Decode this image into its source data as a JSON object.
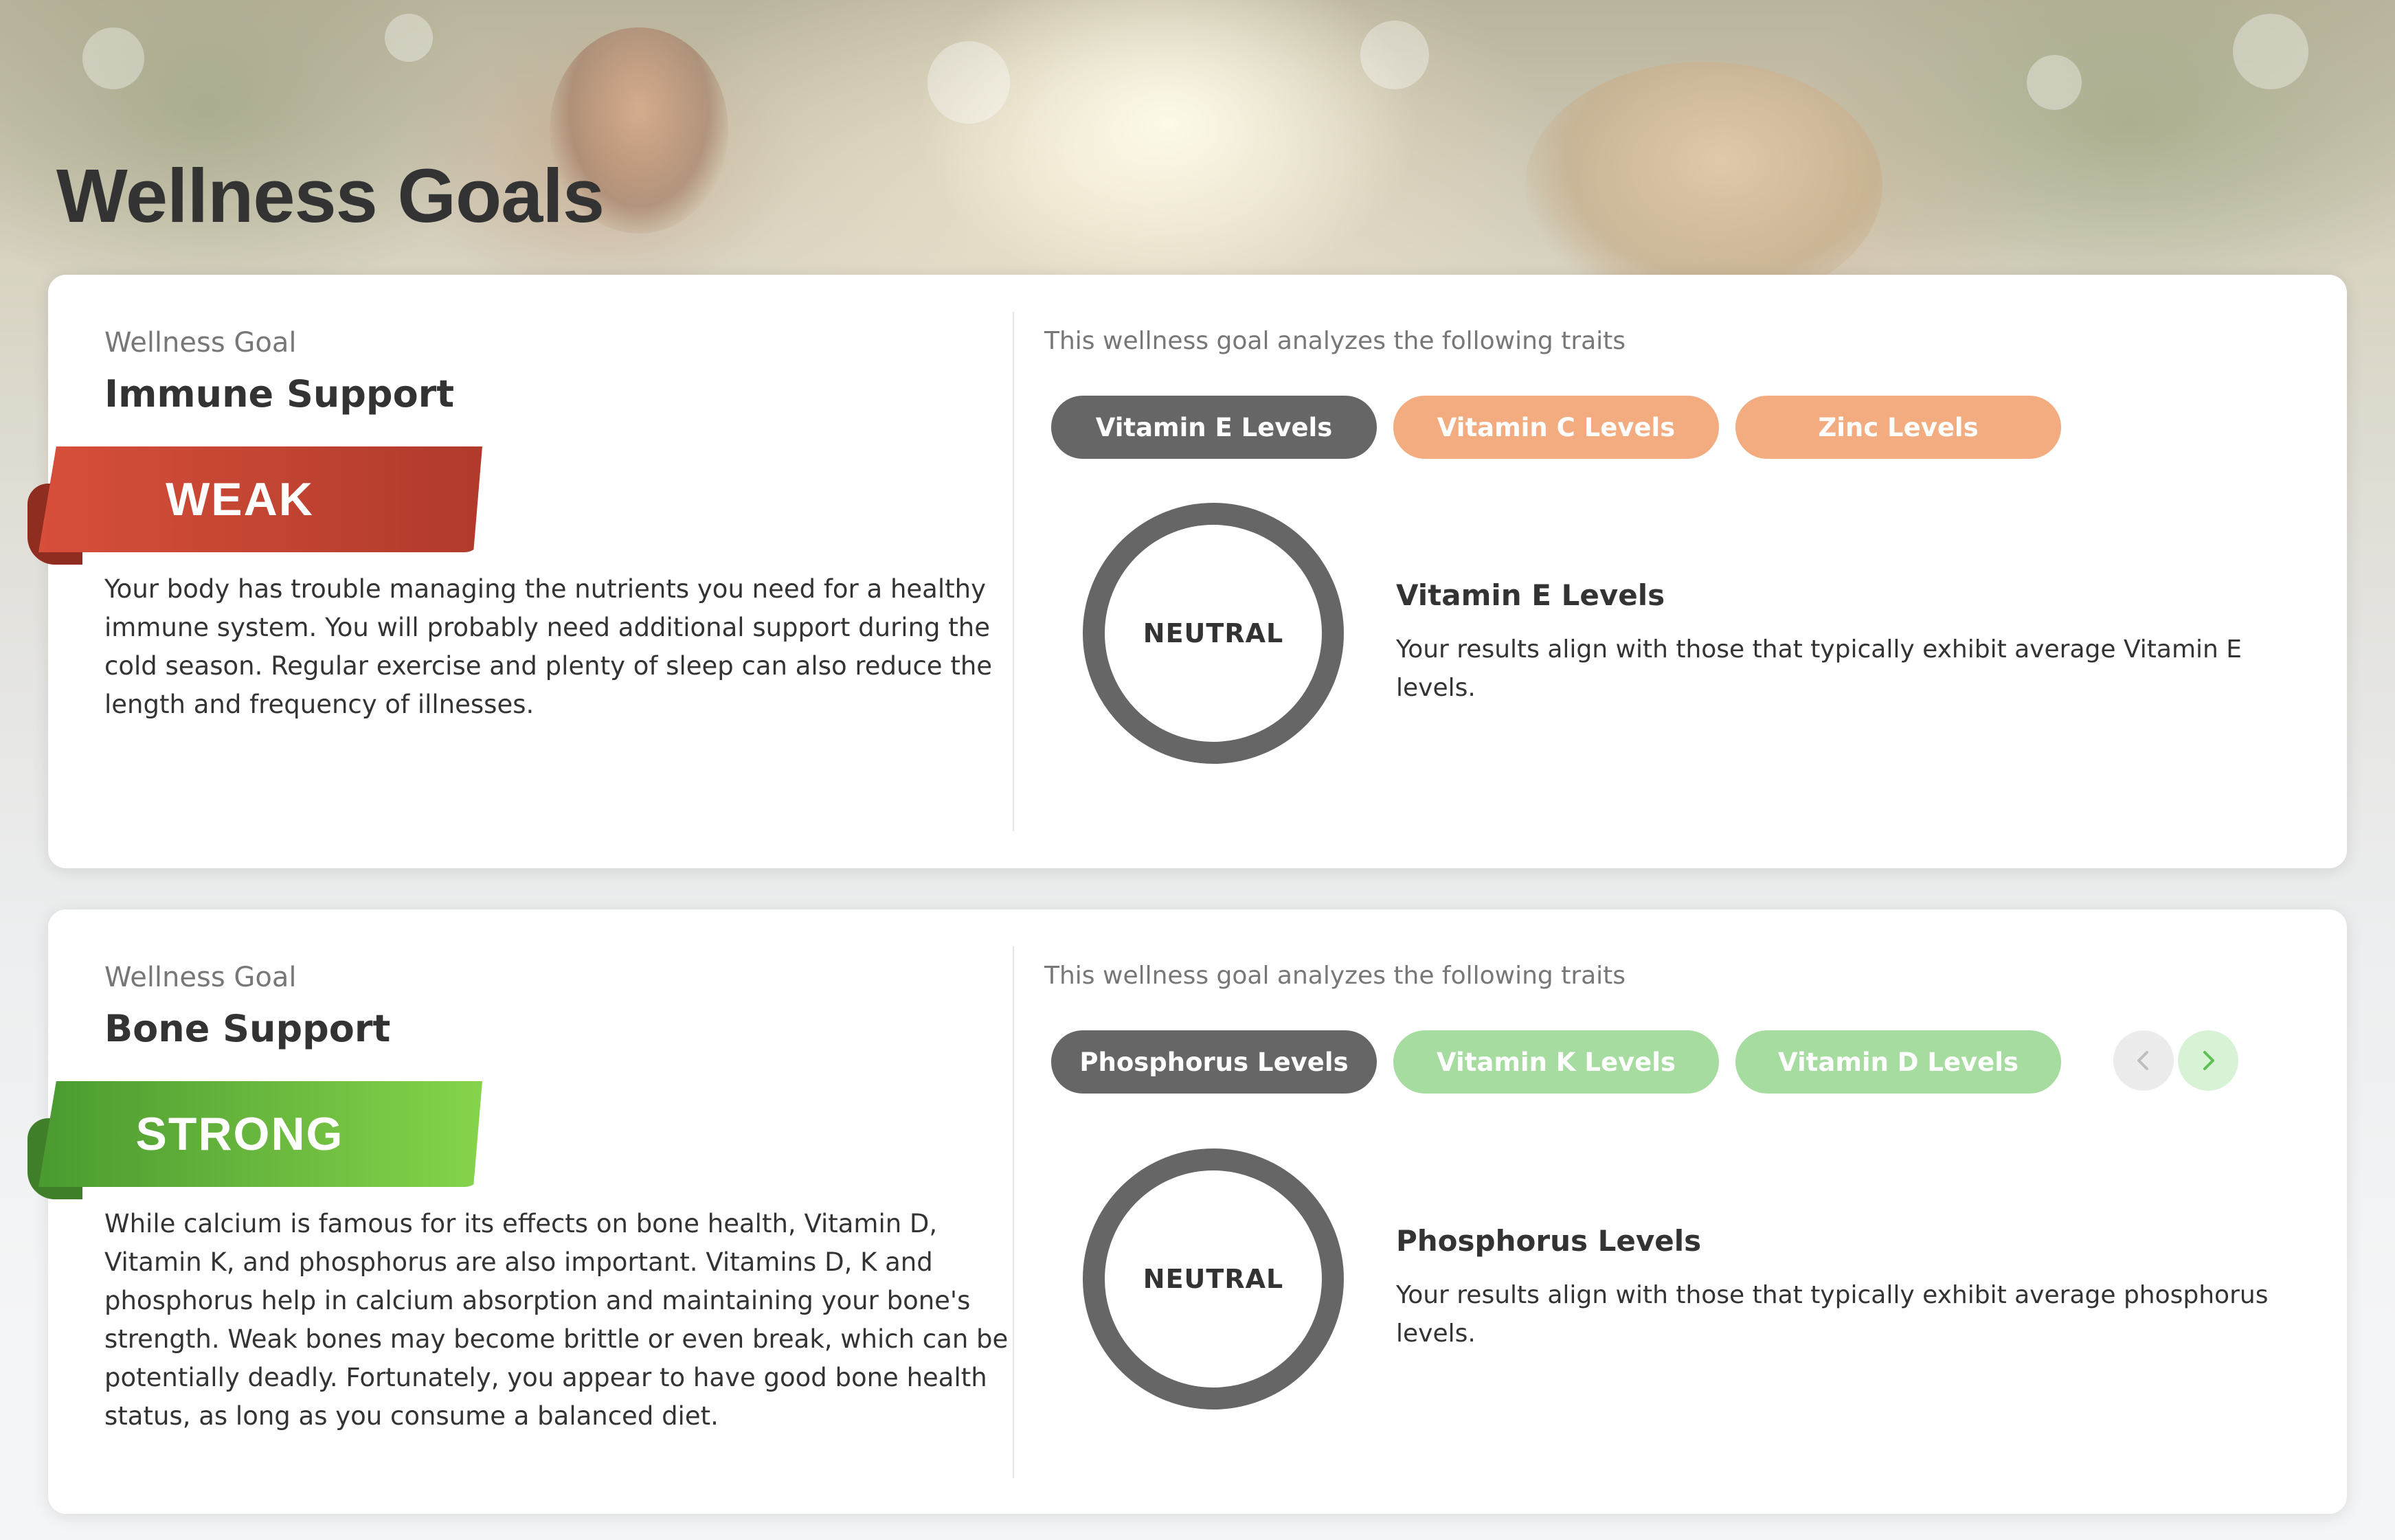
{
  "page": {
    "title": "Wellness Goals"
  },
  "goals": [
    {
      "label": "Wellness Goal",
      "name": "Immune Support",
      "rating": "WEAK",
      "description": "Your body has trouble managing the nutrients you need for a healthy immune system. You will probably need additional support during the cold season. Regular exercise and plenty of sleep can also reduce the length and frequency of illnesses.",
      "traits_label": "This wellness goal analyzes the following traits",
      "traits": [
        "Vitamin E Levels",
        "Vitamin C Levels",
        "Zinc Levels"
      ],
      "selected": {
        "result": "NEUTRAL",
        "title": "Vitamin E Levels",
        "description": "Your results align with those that typically exhibit average Vitamin E levels."
      }
    },
    {
      "label": "Wellness Goal",
      "name": "Bone Support",
      "rating": "STRONG",
      "description": "While calcium is famous for its effects on bone health, Vitamin D, Vitamin K, and phosphorus are also important. Vitamins D, K and phosphorus help in calcium absorption and maintaining your bone's strength. Weak bones may become brittle or even break, which can be potentially deadly. Fortunately, you appear to have good bone health status, as long as you consume a balanced diet.",
      "traits_label": "This wellness goal analyzes the following traits",
      "traits": [
        "Phosphorus Levels",
        "Vitamin K Levels",
        "Vitamin D Levels"
      ],
      "selected": {
        "result": "NEUTRAL",
        "title": "Phosphorus Levels",
        "description": "Your results align with those that typically exhibit average phosphorus levels."
      }
    }
  ],
  "icons": {
    "prev": "chevron-left-icon",
    "next": "chevron-right-icon"
  },
  "colors": {
    "weak": "#c9452f",
    "strong": "#6cbf3e",
    "active_chip": "#666666",
    "weak_chip": "#f2ac80",
    "strong_chip": "#a6dca0"
  }
}
